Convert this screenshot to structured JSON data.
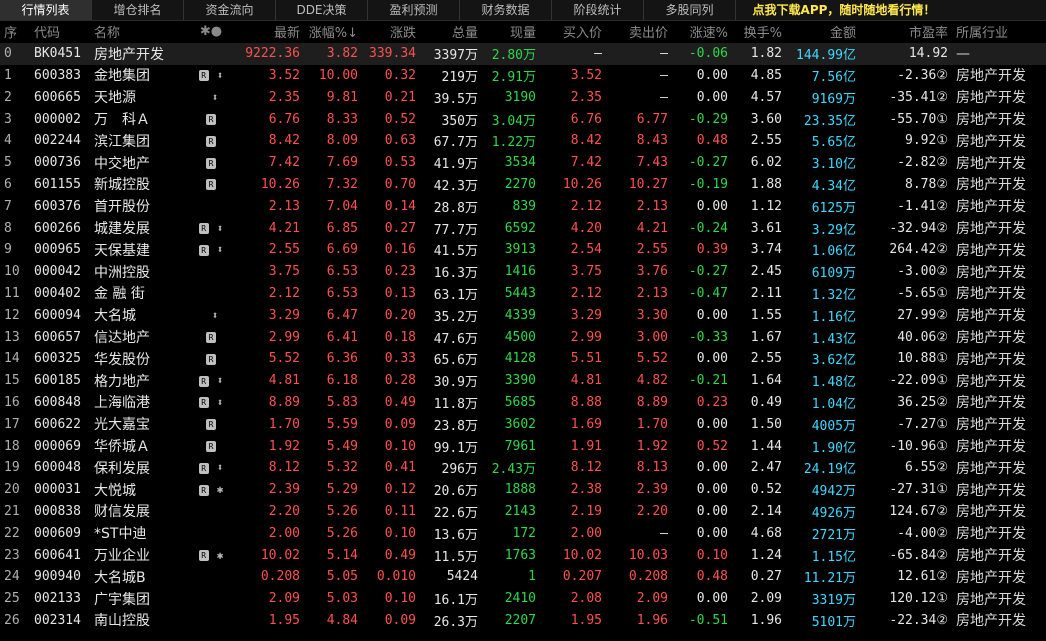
{
  "tabs": [
    "行情列表",
    "增仓排名",
    "资金流向",
    "DDE决策",
    "盈利预测",
    "财务数据",
    "阶段统计",
    "多股同列",
    "点我下载APP，随时随地看行情！"
  ],
  "headers": {
    "idx": "序",
    "code": "代码",
    "name": "名称",
    "marks": "✱●",
    "price": "最新",
    "pct": "涨幅%↓",
    "chg": "涨跌",
    "vol": "总量",
    "cur": "现量",
    "bid": "买入价",
    "ask": "卖出价",
    "speed": "涨速%",
    "turnover": "换手%",
    "amount": "金额",
    "pe": "市盈率",
    "industry": "所属行业"
  },
  "rows": [
    {
      "idx": "0",
      "code": "BK0451",
      "name": "房地产开发",
      "r": "",
      "m": "",
      "price": "9222.36",
      "pct": "3.82",
      "chg": "339.34",
      "vol": "3397万",
      "cur": "2.80万",
      "bid": "—",
      "ask": "—",
      "speed": "-0.06",
      "turnover": "1.82",
      "amount": "144.99亿",
      "pe": "14.92",
      "industry": "—"
    },
    {
      "idx": "1",
      "code": "600383",
      "name": "金地集团",
      "r": "R",
      "m": "⬍",
      "price": "3.52",
      "pct": "10.00",
      "chg": "0.32",
      "vol": "219万",
      "cur": "2.91万",
      "bid": "3.52",
      "ask": "—",
      "speed": "0.00",
      "turnover": "4.85",
      "amount": "7.56亿",
      "pe": "-2.36②",
      "industry": "房地产开发"
    },
    {
      "idx": "2",
      "code": "600665",
      "name": "天地源",
      "r": "",
      "m": "⬍",
      "price": "2.35",
      "pct": "9.81",
      "chg": "0.21",
      "vol": "39.5万",
      "cur": "3190",
      "bid": "2.35",
      "ask": "—",
      "speed": "0.00",
      "turnover": "4.57",
      "amount": "9169万",
      "pe": "-35.41②",
      "industry": "房地产开发"
    },
    {
      "idx": "3",
      "code": "000002",
      "name": "万　科Ａ",
      "r": "R",
      "m": "",
      "price": "6.76",
      "pct": "8.33",
      "chg": "0.52",
      "vol": "350万",
      "cur": "3.04万",
      "bid": "6.76",
      "ask": "6.77",
      "speed": "-0.29",
      "turnover": "3.60",
      "amount": "23.35亿",
      "pe": "-55.70①",
      "industry": "房地产开发"
    },
    {
      "idx": "4",
      "code": "002244",
      "name": "滨江集团",
      "r": "R",
      "m": "",
      "price": "8.42",
      "pct": "8.09",
      "chg": "0.63",
      "vol": "67.7万",
      "cur": "1.22万",
      "bid": "8.42",
      "ask": "8.43",
      "speed": "0.48",
      "turnover": "2.55",
      "amount": "5.65亿",
      "pe": "9.92①",
      "industry": "房地产开发"
    },
    {
      "idx": "5",
      "code": "000736",
      "name": "中交地产",
      "r": "R",
      "m": "",
      "price": "7.42",
      "pct": "7.69",
      "chg": "0.53",
      "vol": "41.9万",
      "cur": "3534",
      "bid": "7.42",
      "ask": "7.43",
      "speed": "-0.27",
      "turnover": "6.02",
      "amount": "3.10亿",
      "pe": "-2.82②",
      "industry": "房地产开发"
    },
    {
      "idx": "6",
      "code": "601155",
      "name": "新城控股",
      "r": "R",
      "m": "",
      "price": "10.26",
      "pct": "7.32",
      "chg": "0.70",
      "vol": "42.3万",
      "cur": "2270",
      "bid": "10.26",
      "ask": "10.27",
      "speed": "-0.19",
      "turnover": "1.88",
      "amount": "4.34亿",
      "pe": "8.78②",
      "industry": "房地产开发"
    },
    {
      "idx": "7",
      "code": "600376",
      "name": "首开股份",
      "r": "",
      "m": "",
      "price": "2.13",
      "pct": "7.04",
      "chg": "0.14",
      "vol": "28.8万",
      "cur": "839",
      "bid": "2.12",
      "ask": "2.13",
      "speed": "0.00",
      "turnover": "1.12",
      "amount": "6125万",
      "pe": "-1.41②",
      "industry": "房地产开发"
    },
    {
      "idx": "8",
      "code": "600266",
      "name": "城建发展",
      "r": "R",
      "m": "⬍",
      "price": "4.21",
      "pct": "6.85",
      "chg": "0.27",
      "vol": "77.7万",
      "cur": "6592",
      "bid": "4.20",
      "ask": "4.21",
      "speed": "-0.24",
      "turnover": "3.61",
      "amount": "3.29亿",
      "pe": "-32.94②",
      "industry": "房地产开发"
    },
    {
      "idx": "9",
      "code": "000965",
      "name": "天保基建",
      "r": "R",
      "m": "⬍",
      "price": "2.55",
      "pct": "6.69",
      "chg": "0.16",
      "vol": "41.5万",
      "cur": "3913",
      "bid": "2.54",
      "ask": "2.55",
      "speed": "0.39",
      "turnover": "3.74",
      "amount": "1.06亿",
      "pe": "264.42②",
      "industry": "房地产开发"
    },
    {
      "idx": "10",
      "code": "000042",
      "name": "中洲控股",
      "r": "",
      "m": "",
      "price": "3.75",
      "pct": "6.53",
      "chg": "0.23",
      "vol": "16.3万",
      "cur": "1416",
      "bid": "3.75",
      "ask": "3.76",
      "speed": "-0.27",
      "turnover": "2.45",
      "amount": "6109万",
      "pe": "-3.00②",
      "industry": "房地产开发"
    },
    {
      "idx": "11",
      "code": "000402",
      "name": "金 融 街",
      "r": "",
      "m": "",
      "price": "2.12",
      "pct": "6.53",
      "chg": "0.13",
      "vol": "63.1万",
      "cur": "5443",
      "bid": "2.12",
      "ask": "2.13",
      "speed": "-0.47",
      "turnover": "2.11",
      "amount": "1.32亿",
      "pe": "-5.65①",
      "industry": "房地产开发"
    },
    {
      "idx": "12",
      "code": "600094",
      "name": "大名城",
      "r": "",
      "m": "⬍",
      "price": "3.29",
      "pct": "6.47",
      "chg": "0.20",
      "vol": "35.2万",
      "cur": "4339",
      "bid": "3.29",
      "ask": "3.30",
      "speed": "0.00",
      "turnover": "1.55",
      "amount": "1.16亿",
      "pe": "27.99②",
      "industry": "房地产开发"
    },
    {
      "idx": "13",
      "code": "600657",
      "name": "信达地产",
      "r": "R",
      "m": "",
      "price": "2.99",
      "pct": "6.41",
      "chg": "0.18",
      "vol": "47.6万",
      "cur": "4500",
      "bid": "2.99",
      "ask": "3.00",
      "speed": "-0.33",
      "turnover": "1.67",
      "amount": "1.43亿",
      "pe": "40.06②",
      "industry": "房地产开发"
    },
    {
      "idx": "14",
      "code": "600325",
      "name": "华发股份",
      "r": "R",
      "m": "",
      "price": "5.52",
      "pct": "6.36",
      "chg": "0.33",
      "vol": "65.6万",
      "cur": "4128",
      "bid": "5.51",
      "ask": "5.52",
      "speed": "0.00",
      "turnover": "2.55",
      "amount": "3.62亿",
      "pe": "10.88①",
      "industry": "房地产开发"
    },
    {
      "idx": "15",
      "code": "600185",
      "name": "格力地产",
      "r": "R",
      "m": "⬍",
      "price": "4.81",
      "pct": "6.18",
      "chg": "0.28",
      "vol": "30.9万",
      "cur": "3390",
      "bid": "4.81",
      "ask": "4.82",
      "speed": "-0.21",
      "turnover": "1.64",
      "amount": "1.48亿",
      "pe": "-22.09①",
      "industry": "房地产开发"
    },
    {
      "idx": "16",
      "code": "600848",
      "name": "上海临港",
      "r": "R",
      "m": "⬍",
      "price": "8.89",
      "pct": "5.83",
      "chg": "0.49",
      "vol": "11.8万",
      "cur": "5685",
      "bid": "8.88",
      "ask": "8.89",
      "speed": "0.23",
      "turnover": "0.49",
      "amount": "1.04亿",
      "pe": "36.25②",
      "industry": "房地产开发"
    },
    {
      "idx": "17",
      "code": "600622",
      "name": "光大嘉宝",
      "r": "R",
      "m": "",
      "price": "1.70",
      "pct": "5.59",
      "chg": "0.09",
      "vol": "23.8万",
      "cur": "3602",
      "bid": "1.69",
      "ask": "1.70",
      "speed": "0.00",
      "turnover": "1.50",
      "amount": "4005万",
      "pe": "-7.27①",
      "industry": "房地产开发"
    },
    {
      "idx": "18",
      "code": "000069",
      "name": "华侨城Ａ",
      "r": "R",
      "m": "",
      "price": "1.92",
      "pct": "5.49",
      "chg": "0.10",
      "vol": "99.1万",
      "cur": "7961",
      "bid": "1.91",
      "ask": "1.92",
      "speed": "0.52",
      "turnover": "1.44",
      "amount": "1.90亿",
      "pe": "-10.96①",
      "industry": "房地产开发"
    },
    {
      "idx": "19",
      "code": "600048",
      "name": "保利发展",
      "r": "R",
      "m": "⬍",
      "price": "8.12",
      "pct": "5.32",
      "chg": "0.41",
      "vol": "296万",
      "cur": "2.43万",
      "bid": "8.12",
      "ask": "8.13",
      "speed": "0.00",
      "turnover": "2.47",
      "amount": "24.19亿",
      "pe": "6.55②",
      "industry": "房地产开发"
    },
    {
      "idx": "20",
      "code": "000031",
      "name": "大悦城",
      "r": "R",
      "m": "✱",
      "price": "2.39",
      "pct": "5.29",
      "chg": "0.12",
      "vol": "20.6万",
      "cur": "1888",
      "bid": "2.38",
      "ask": "2.39",
      "speed": "0.00",
      "turnover": "0.52",
      "amount": "4942万",
      "pe": "-27.31①",
      "industry": "房地产开发"
    },
    {
      "idx": "21",
      "code": "000838",
      "name": "财信发展",
      "r": "",
      "m": "",
      "price": "2.20",
      "pct": "5.26",
      "chg": "0.11",
      "vol": "22.6万",
      "cur": "2143",
      "bid": "2.19",
      "ask": "2.20",
      "speed": "0.00",
      "turnover": "2.14",
      "amount": "4926万",
      "pe": "124.67②",
      "industry": "房地产开发"
    },
    {
      "idx": "22",
      "code": "000609",
      "name": "*ST中迪",
      "r": "",
      "m": "",
      "price": "2.00",
      "pct": "5.26",
      "chg": "0.10",
      "vol": "13.6万",
      "cur": "172",
      "bid": "2.00",
      "ask": "—",
      "speed": "0.00",
      "turnover": "4.68",
      "amount": "2721万",
      "pe": "-4.00②",
      "industry": "房地产开发"
    },
    {
      "idx": "23",
      "code": "600641",
      "name": "万业企业",
      "r": "R",
      "m": "✱",
      "price": "10.02",
      "pct": "5.14",
      "chg": "0.49",
      "vol": "11.5万",
      "cur": "1763",
      "bid": "10.02",
      "ask": "10.03",
      "speed": "0.10",
      "turnover": "1.24",
      "amount": "1.15亿",
      "pe": "-65.84②",
      "industry": "房地产开发"
    },
    {
      "idx": "24",
      "code": "900940",
      "name": "大名城B",
      "r": "",
      "m": "",
      "price": "0.208",
      "pct": "5.05",
      "chg": "0.010",
      "vol": "5424",
      "cur": "1",
      "bid": "0.207",
      "ask": "0.208",
      "speed": "0.48",
      "turnover": "0.27",
      "amount": "11.21万",
      "pe": "12.61②",
      "industry": "房地产开发"
    },
    {
      "idx": "25",
      "code": "002133",
      "name": "广宇集团",
      "r": "",
      "m": "",
      "price": "2.09",
      "pct": "5.03",
      "chg": "0.10",
      "vol": "16.1万",
      "cur": "2410",
      "bid": "2.08",
      "ask": "2.09",
      "speed": "0.00",
      "turnover": "2.09",
      "amount": "3319万",
      "pe": "120.12①",
      "industry": "房地产开发"
    },
    {
      "idx": "26",
      "code": "002314",
      "name": "南山控股",
      "r": "",
      "m": "",
      "price": "1.95",
      "pct": "4.84",
      "chg": "0.09",
      "vol": "26.3万",
      "cur": "2207",
      "bid": "1.95",
      "ask": "1.96",
      "speed": "-0.51",
      "turnover": "1.96",
      "amount": "5101万",
      "pe": "-22.34②",
      "industry": "房地产开发"
    }
  ]
}
